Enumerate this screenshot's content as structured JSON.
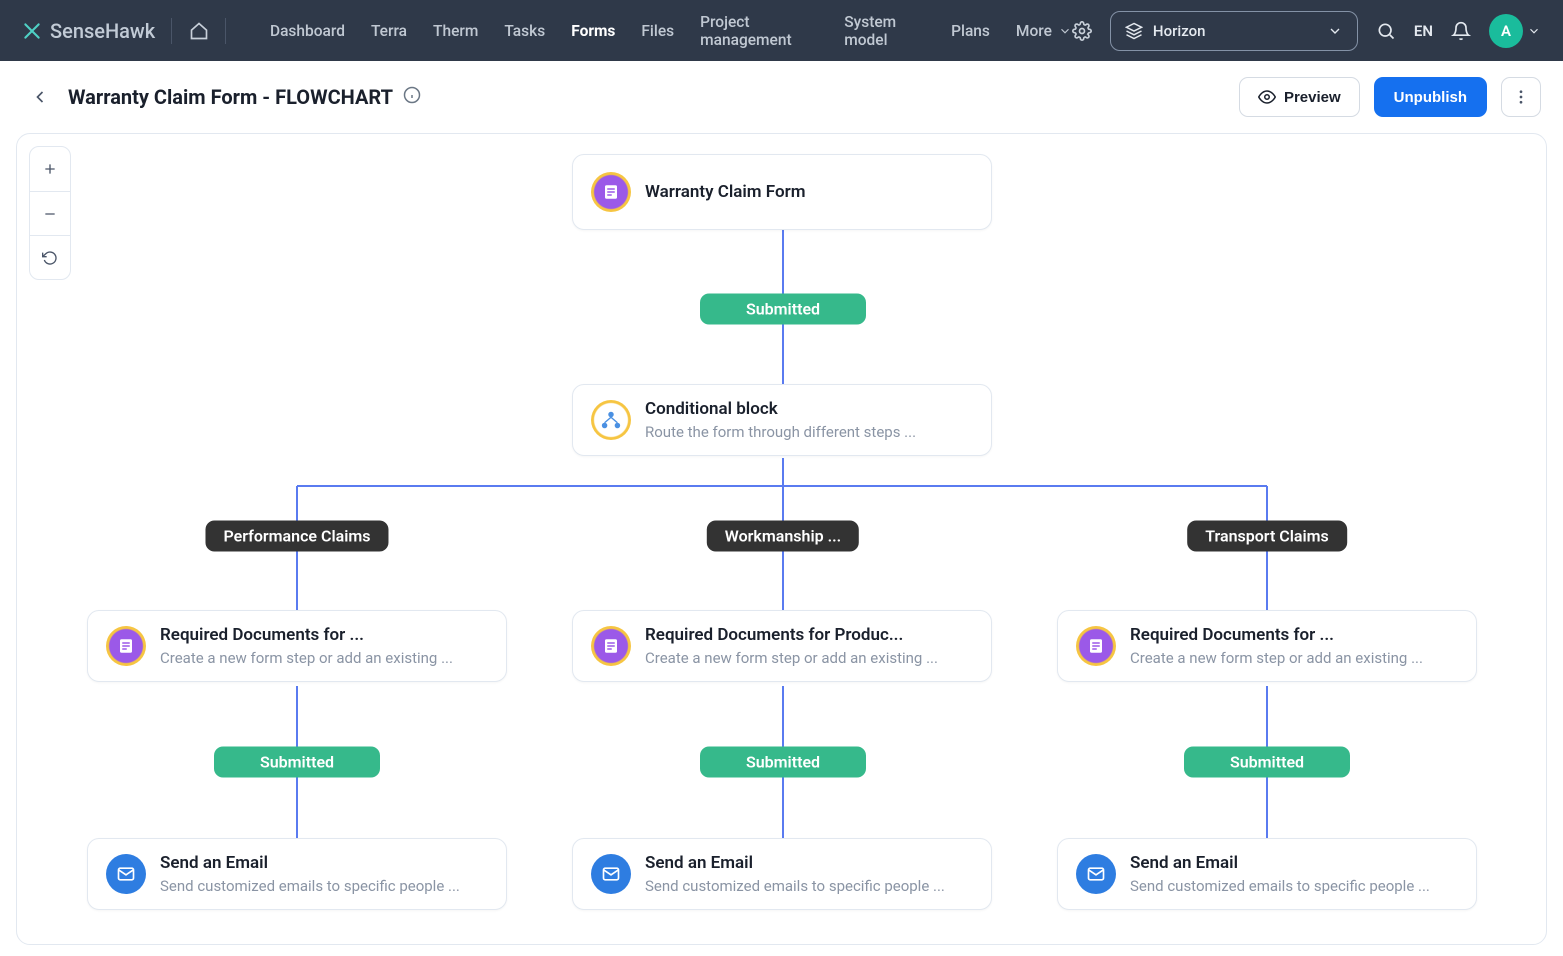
{
  "brand": {
    "name": "SenseHawk"
  },
  "nav": {
    "items": [
      "Dashboard",
      "Terra",
      "Therm",
      "Tasks",
      "Forms",
      "Files",
      "Project management",
      "System model",
      "Plans"
    ],
    "active_index": 4,
    "more": "More"
  },
  "project": {
    "name": "Horizon"
  },
  "lang": "EN",
  "avatar_initial": "A",
  "page": {
    "title": "Warranty Claim Form - FLOWCHART",
    "preview": "Preview",
    "unpublish": "Unpublish"
  },
  "flow": {
    "root_title": "Warranty Claim Form",
    "submitted": "Submitted",
    "cond_title": "Conditional block",
    "cond_sub": "Route the form through different steps ...",
    "branch_labels": [
      "Performance Claims",
      "Workmanship ...",
      "Transport Claims"
    ],
    "doc_titles": [
      "Required Documents for ...",
      "Required Documents for Produc...",
      "Required Documents for ..."
    ],
    "doc_sub": "Create a new form step or add an existing ...",
    "email_title": "Send an Email",
    "email_sub": "Send customized emails to specific people ..."
  }
}
